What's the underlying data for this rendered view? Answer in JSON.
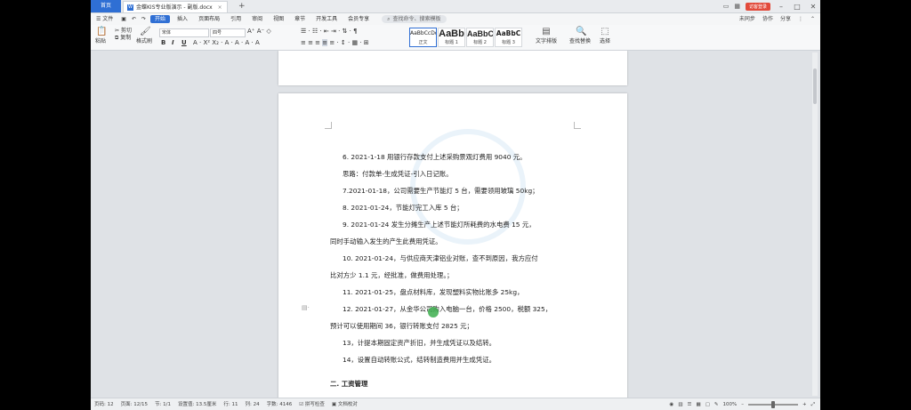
{
  "titlebar": {
    "home_tab": "首页",
    "doc_tab": "金蝶KIS专业版演示 - 副版.docx",
    "doc_icon": "W",
    "new_tab": "+",
    "right": {
      "sync": "未同步",
      "collab": "协作",
      "share": "分享",
      "user": "访客登录"
    }
  },
  "menu": {
    "file": "☰ 文件",
    "items": [
      "开始",
      "插入",
      "页面布局",
      "引用",
      "审阅",
      "视图",
      "章节",
      "开发工具",
      "会员专享"
    ],
    "active_index": 0,
    "search_placeholder": "查找命令、搜索模板"
  },
  "ribbon": {
    "paste": "粘贴",
    "cut": "剪切",
    "copy": "复制",
    "format_painter": "格式刷",
    "font_name": "宋体",
    "font_size": "四号",
    "styles": [
      {
        "sample": "AaBbCcDd",
        "name": "正文"
      },
      {
        "sample": "AaBb",
        "name": "标题 1"
      },
      {
        "sample": "AaBbC",
        "name": "标题 2"
      },
      {
        "sample": "AaBbC",
        "name": "标题 3"
      }
    ],
    "text_layout": "文字排版",
    "find_replace": "查找替换",
    "select": "选择"
  },
  "document": {
    "paragraphs": [
      "6. 2021-1-18 用银行存款支付上述采购景观灯费用 9040 元。",
      "思路：付款单-生成凭证-引入日记账。",
      "7.2021-01-18，公司需要生产节能灯 5 台，需要领用玻璃 50kg；",
      "8. 2021-01-24，节能灯完工入库 5 台；",
      "9. 2021-01-24 发生分摊生产上述节能灯所耗费的水电费 15 元，",
      "同时手动输入发生的产生此费用凭证。",
      "10. 2021-01-24，与供应商天津铝业对账，查不到原因，我方应付",
      "比对方少 1.1 元，经批准，做费用处理。；",
      "11. 2021-01-25，盘点材料库，发现塑料实物比账多 25kg，",
      "12. 2021-01-27，从金华公司购入电脑一台，价格 2500，税额 325，",
      "预计可以使用期间 36，银行转账支付 2825 元；",
      "13，计提本期固定资产折旧，并生成凭证以及结转。",
      "14，设置自动转账公式，结转制造费用并生成凭证。",
      "二. 工资管理"
    ]
  },
  "status": {
    "page_num": "页码: 12",
    "pages": "页面: 12/15",
    "section": "节: 1/1",
    "setting": "设置值: 13.5厘米",
    "row": "行: 11",
    "col": "列: 24",
    "words": "字数: 4146",
    "spell": "拼写检查",
    "proof": "文档校对",
    "zoom": "100%",
    "zoom_level": 0.5
  }
}
